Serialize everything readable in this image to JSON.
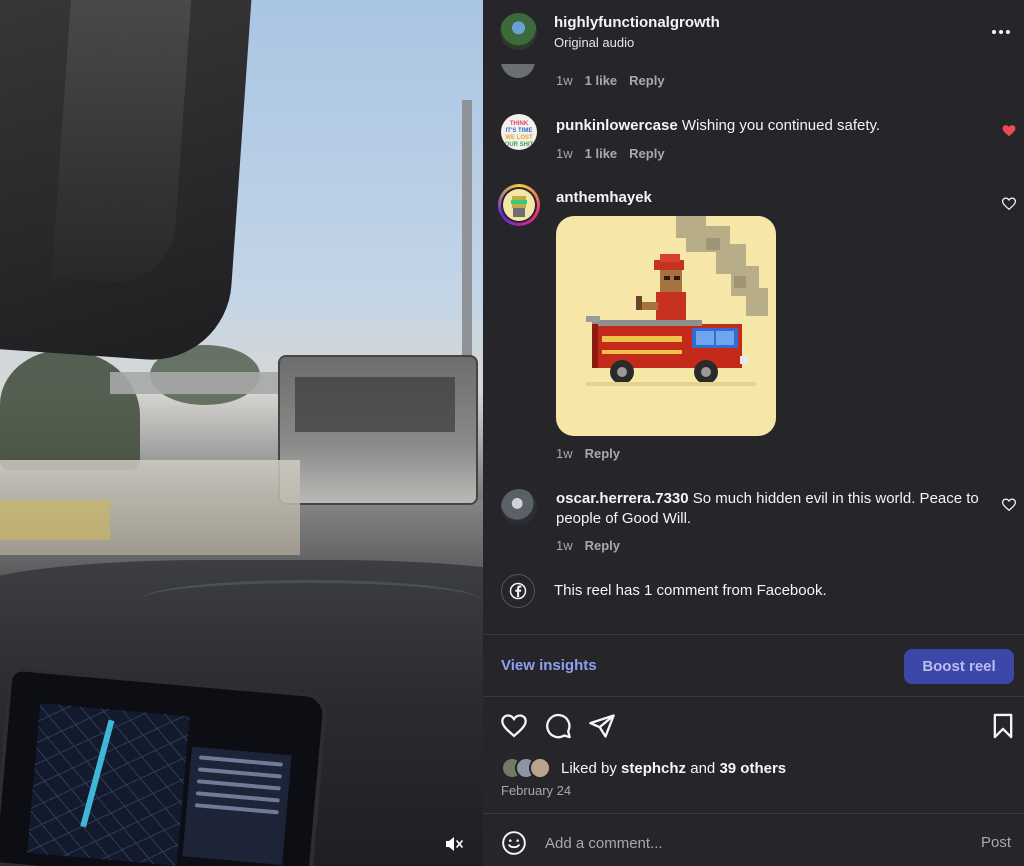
{
  "header": {
    "username": "highlyfunctionalgrowth",
    "audio": "Original audio",
    "more_icon": "more-horizontal-icon"
  },
  "comments": [
    {
      "time": "1w",
      "likes": "1 like",
      "reply": "Reply"
    },
    {
      "username": "punkinlowercase",
      "text": "Wishing you continued safety.",
      "time": "1w",
      "likes": "1 like",
      "reply": "Reply",
      "liked": true,
      "avatar_text": "THINK IT'S TIME WE LOST OUR SHIT"
    },
    {
      "username": "anthemhayek",
      "sticker": "pixel-art fire truck with firefighter",
      "time": "1w",
      "reply": "Reply",
      "liked": false
    },
    {
      "username": "oscar.herrera.7330",
      "text": "So much hidden evil in this world. Peace to people of Good Will.",
      "time": "1w",
      "reply": "Reply",
      "liked": false
    }
  ],
  "facebook_note": "This reel has 1 comment from Facebook.",
  "insights_label": "View insights",
  "boost_label": "Boost reel",
  "likes": {
    "prefix": "Liked by ",
    "user": "stephchz",
    "middle": " and ",
    "others": "39 others"
  },
  "date": "February 24",
  "comment_input": {
    "placeholder": "Add a comment...",
    "post_label": "Post"
  },
  "colors": {
    "panel_bg": "#25252a",
    "link": "#8fa0f0",
    "boost_bg": "#3d47a8",
    "heart_red": "#ed4956"
  }
}
